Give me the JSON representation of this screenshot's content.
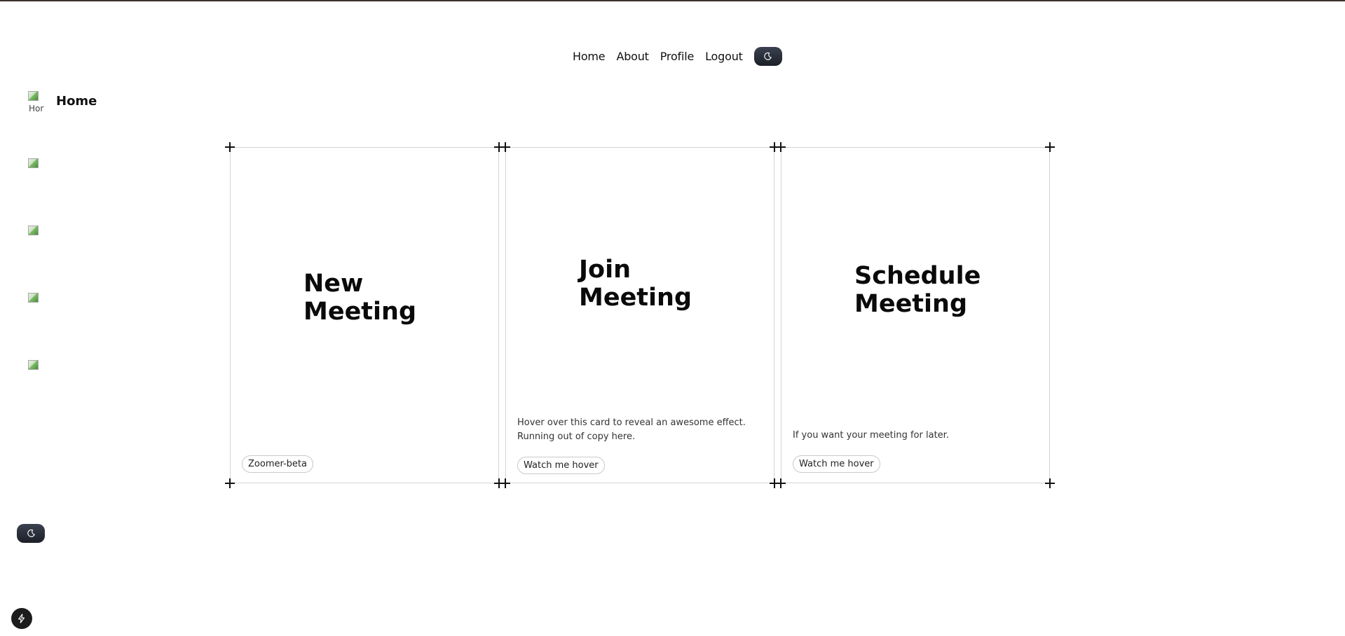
{
  "nav": {
    "items": [
      {
        "label": "Home"
      },
      {
        "label": "About"
      },
      {
        "label": "Profile"
      },
      {
        "label": "Logout"
      }
    ],
    "theme_toggle_icon": "moon-icon"
  },
  "sidebar": {
    "items": [
      {
        "label": "Home",
        "image_alt": "Hor",
        "icon": "broken-image-icon"
      },
      {
        "label": "",
        "image_alt": "",
        "icon": "broken-image-icon"
      },
      {
        "label": "",
        "image_alt": "",
        "icon": "broken-image-icon"
      },
      {
        "label": "",
        "image_alt": "",
        "icon": "broken-image-icon"
      },
      {
        "label": "",
        "image_alt": "",
        "icon": "broken-image-icon"
      }
    ],
    "theme_toggle_icon": "moon-icon"
  },
  "cards": [
    {
      "title_line1": "New",
      "title_line2": "Meeting",
      "description": "",
      "button": "Zoomer-beta"
    },
    {
      "title_line1": "Join",
      "title_line2": "Meeting",
      "description": "Hover over this card to reveal an awesome effect. Running out of copy here.",
      "button": "Watch me hover"
    },
    {
      "title_line1": "Schedule",
      "title_line2": "Meeting",
      "description": "If you want your meeting for later.",
      "button": "Watch me hover"
    }
  ],
  "floating_button_icon": "bolt-icon",
  "colors": {
    "toggle_bg": "#1b1f27",
    "border": "#d4d4d4",
    "top_line": "#3a302c"
  }
}
